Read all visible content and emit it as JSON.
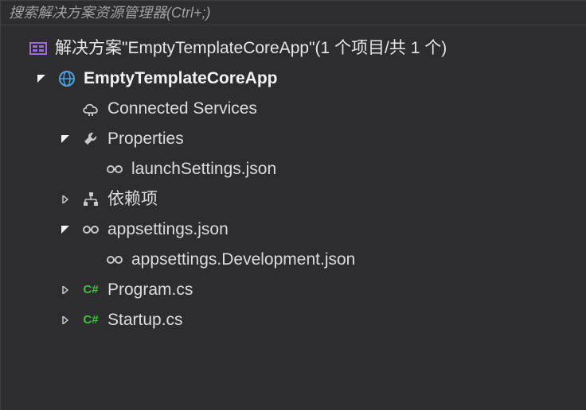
{
  "search": {
    "placeholder": "搜索解决方案资源管理器(Ctrl+;)"
  },
  "solution": {
    "prefix": "解决方案",
    "name": "EmptyTemplateCoreApp",
    "suffix": "(1 个项目/共 1 个)"
  },
  "project": {
    "name": "EmptyTemplateCoreApp",
    "nodes": {
      "connected_services": "Connected Services",
      "properties": "Properties",
      "launch_settings": "launchSettings.json",
      "dependencies": "依赖项",
      "appsettings": "appsettings.json",
      "appsettings_dev": "appsettings.Development.json",
      "program": "Program.cs",
      "startup": "Startup.cs"
    }
  },
  "icon_labels": {
    "cs": "C#"
  }
}
